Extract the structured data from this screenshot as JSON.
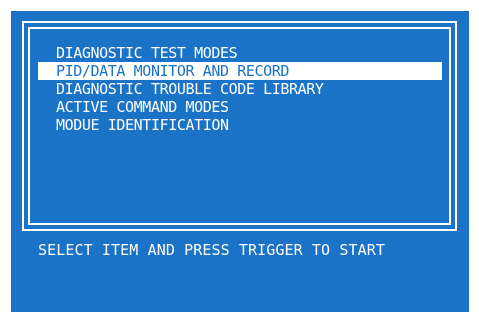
{
  "screen": {
    "background_color": "#1a73c6",
    "foreground_color": "#ffffff"
  },
  "menu": {
    "selected_index": 1,
    "items": [
      {
        "label": "DIAGNOSTIC TEST MODES"
      },
      {
        "label": "PID/DATA MONITOR AND RECORD"
      },
      {
        "label": "DIAGNOSTIC TROUBLE CODE LIBRARY"
      },
      {
        "label": "ACTIVE COMMAND MODES"
      },
      {
        "label": "MODUE IDENTIFICATION"
      }
    ]
  },
  "prompt": {
    "text": "SELECT ITEM AND PRESS TRIGGER TO START"
  }
}
